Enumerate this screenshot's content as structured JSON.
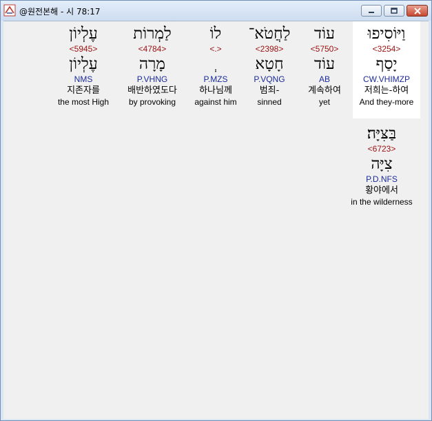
{
  "window": {
    "title": "@원전본해 - 시 78:17"
  },
  "colors": {
    "strong": "#9a1010",
    "morph": "#1a2a9a",
    "selected_bg": "#ffffff"
  },
  "words": [
    {
      "hebrew": "וַיּוֹסִיפוּ",
      "strong": "<3254>",
      "lemma": "יָסַף",
      "morph": "CW.VHIMZP",
      "korean": "저희는-하여",
      "english": "And they-more"
    },
    {
      "hebrew": "עוֹד",
      "strong": "<5750>",
      "lemma": "עוֹד",
      "morph": "AB",
      "korean": "계속하여",
      "english": "yet"
    },
    {
      "hebrew": "לַחֲטֹא־",
      "strong": "<2398>",
      "lemma": "חָטָא",
      "morph": "P.VQNG",
      "korean": "범죄-",
      "english": "sinned"
    },
    {
      "hebrew": "לוֹ",
      "strong": "<.>",
      "lemma": "ְ",
      "morph": "P.MZS",
      "korean": "하나님께",
      "english": "against him"
    },
    {
      "hebrew": "לַמְרוֹת",
      "strong": "<4784>",
      "lemma": "מָרָה",
      "morph": "P.VHNG",
      "korean": "배반하였도다",
      "english": "by provoking"
    },
    {
      "hebrew": "עֶלְיוֹן",
      "strong": "<5945>",
      "lemma": "עֶלְיוֹן",
      "morph": "NMS",
      "korean": "지존자를",
      "english": "the most High"
    },
    {
      "hebrew": "בַּצִּיָּה׃",
      "strong": "<6723>",
      "lemma": "צִיָּה",
      "morph": "P.D.NFS",
      "korean": "황야에서",
      "english": "in the wilderness"
    }
  ]
}
